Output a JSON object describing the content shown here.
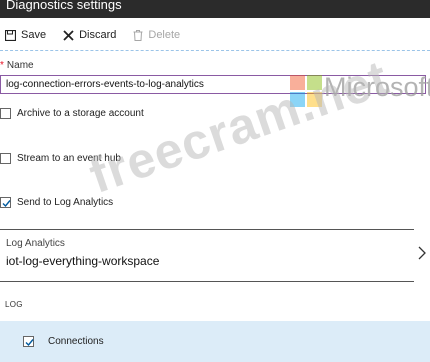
{
  "window": {
    "title": "Diagnostics settings"
  },
  "toolbar": {
    "save_label": "Save",
    "discard_label": "Discard",
    "delete_label": "Delete"
  },
  "form": {
    "name_label": "Name",
    "name_value": "log-connection-errors-events-to-log-analytics",
    "options": [
      {
        "label": "Archive to a storage account",
        "checked": false
      },
      {
        "label": "Stream to an event hub",
        "checked": false
      },
      {
        "label": "Send to Log Analytics",
        "checked": true
      }
    ],
    "log_analytics": {
      "label": "Log Analytics",
      "value": "iot-log-everything-workspace"
    },
    "log_section": {
      "header": "LOG",
      "items": [
        {
          "label": "Connections",
          "checked": true
        }
      ]
    }
  },
  "watermarks": {
    "brand": "Microsoft",
    "site": "freecram.net"
  },
  "colors": {
    "title_bar": "#2b2b2b",
    "input_border": "#8a5aa3",
    "row_highlight": "#dcecf8",
    "checkmark": "#005a9e",
    "required": "#e81123"
  },
  "icons": [
    "save-icon",
    "close-icon",
    "trash-icon",
    "checkmark-icon",
    "chevron-right-icon"
  ]
}
